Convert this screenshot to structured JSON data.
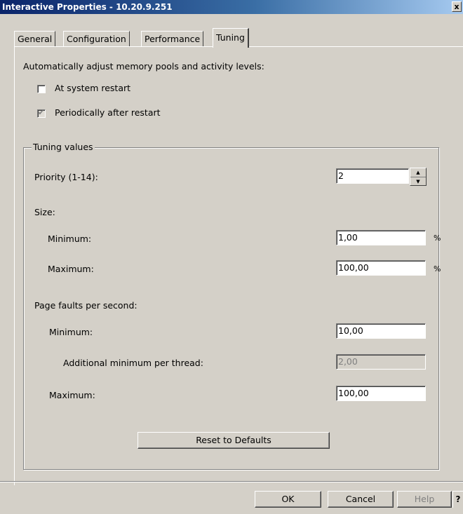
{
  "window": {
    "title": "Interactive Properties - 10.20.9.251",
    "close_glyph": "x"
  },
  "tabs": [
    {
      "label": "General"
    },
    {
      "label": "Configuration"
    },
    {
      "label": "Performance"
    },
    {
      "label": "Tuning",
      "active": true
    }
  ],
  "tuning": {
    "auto_adjust_label": "Automatically adjust memory pools and activity levels:",
    "at_system_restart": {
      "label": "At system restart",
      "checked": false
    },
    "periodically_after_restart": {
      "label": "Periodically after restart",
      "checked": true
    },
    "group_title": "Tuning values",
    "priority": {
      "label": "Priority (1-14):",
      "value": "2"
    },
    "size": {
      "heading": "Size:",
      "minimum_label": "Minimum:",
      "minimum_value": "1,00",
      "maximum_label": "Maximum:",
      "maximum_value": "100,00",
      "unit": "%"
    },
    "page_faults": {
      "heading": "Page faults per second:",
      "minimum_label": "Minimum:",
      "minimum_value": "10,00",
      "additional_label": "Additional minimum per thread:",
      "additional_value": "2,00",
      "maximum_label": "Maximum:",
      "maximum_value": "100,00"
    },
    "reset_button": "Reset to Defaults"
  },
  "buttons": {
    "ok": "OK",
    "cancel": "Cancel",
    "help": "Help",
    "whats_this": "?"
  }
}
